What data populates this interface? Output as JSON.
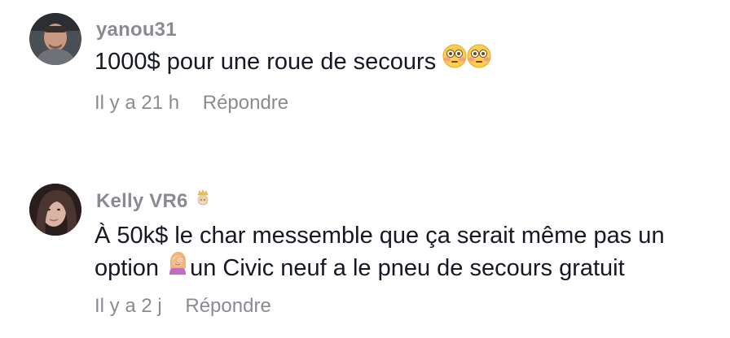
{
  "comments": [
    {
      "username": "yanou31",
      "text": "1000$ pour une roue de secours",
      "emojis": [
        "flushed-face-emoji",
        "flushed-face-emoji"
      ],
      "time": "Il y a 21 h",
      "reply_label": "Répondre"
    },
    {
      "username": "Kelly VR6",
      "badge": "princess-emoji",
      "text_line1": "À 50k$ le char messemble que ça serait même pas un",
      "text_line2_before": "option",
      "text_line2_emoji": "facepalm-emoji",
      "text_line2_after": "un Civic neuf a le pneu de secours gratuit",
      "time": "Il y a 2 j",
      "reply_label": "Répondre"
    }
  ],
  "colors": {
    "text": "#161823",
    "muted": "#8a8b91",
    "background": "#ffffff"
  }
}
